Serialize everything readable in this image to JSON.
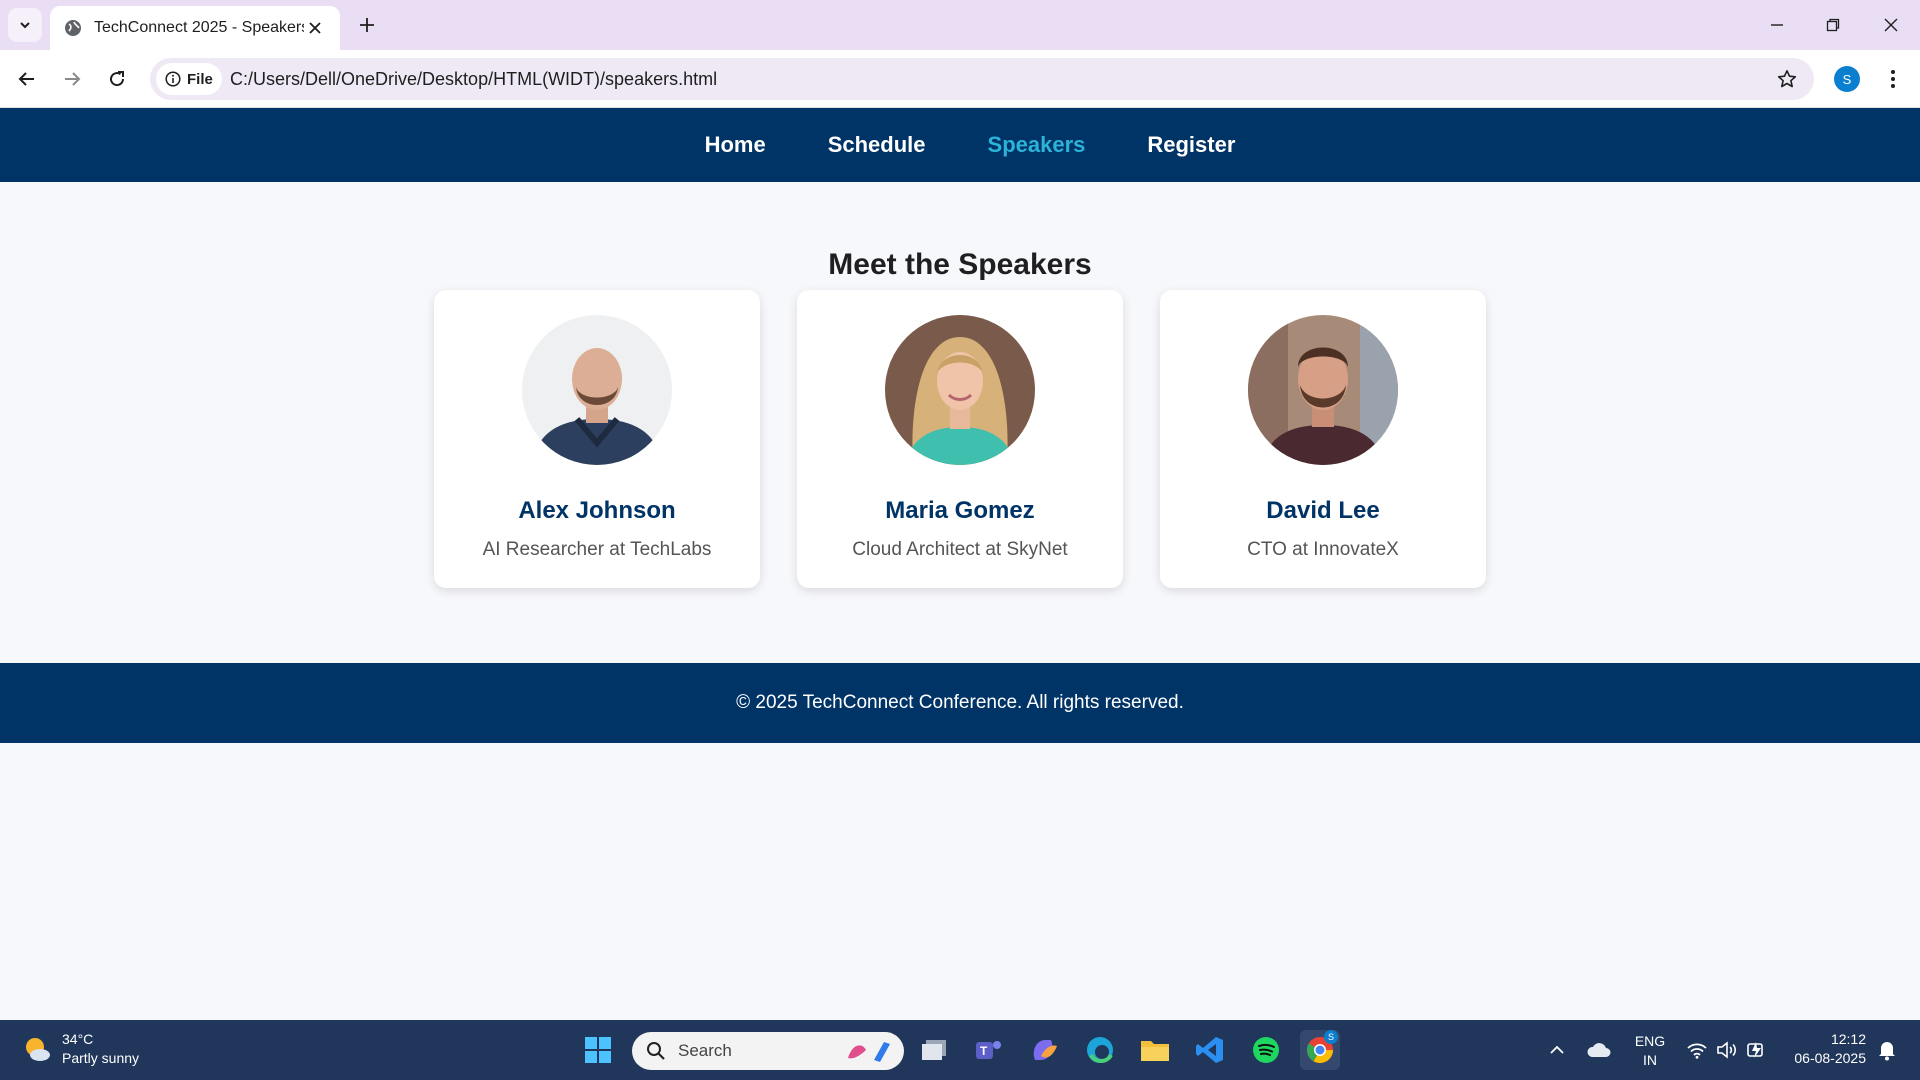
{
  "browser": {
    "tab_title": "TechConnect 2025 - Speakers",
    "chip_label": "File",
    "url": "C:/Users/Dell/OneDrive/Desktop/HTML(WIDT)/speakers.html",
    "profile_initial": "S"
  },
  "nav": {
    "items": [
      {
        "label": "Home"
      },
      {
        "label": "Schedule"
      },
      {
        "label": "Speakers"
      },
      {
        "label": "Register"
      }
    ]
  },
  "main": {
    "title": "Meet the Speakers",
    "speakers": [
      {
        "name": "Alex Johnson",
        "role": "AI Researcher at TechLabs"
      },
      {
        "name": "Maria Gomez",
        "role": "Cloud Architect at SkyNet"
      },
      {
        "name": "David Lee",
        "role": "CTO at InnovateX"
      }
    ]
  },
  "footer": {
    "text": "© 2025 TechConnect Conference. All rights reserved."
  },
  "taskbar": {
    "weather_temp": "34°C",
    "weather_desc": "Partly sunny",
    "search_label": "Search",
    "lang_line1": "ENG",
    "lang_line2": "IN",
    "time": "12:12",
    "date": "06-08-2025",
    "chrome_badge": "S"
  },
  "colors": {
    "brand_navy": "#003366",
    "nav_active": "#2bb3d9"
  }
}
